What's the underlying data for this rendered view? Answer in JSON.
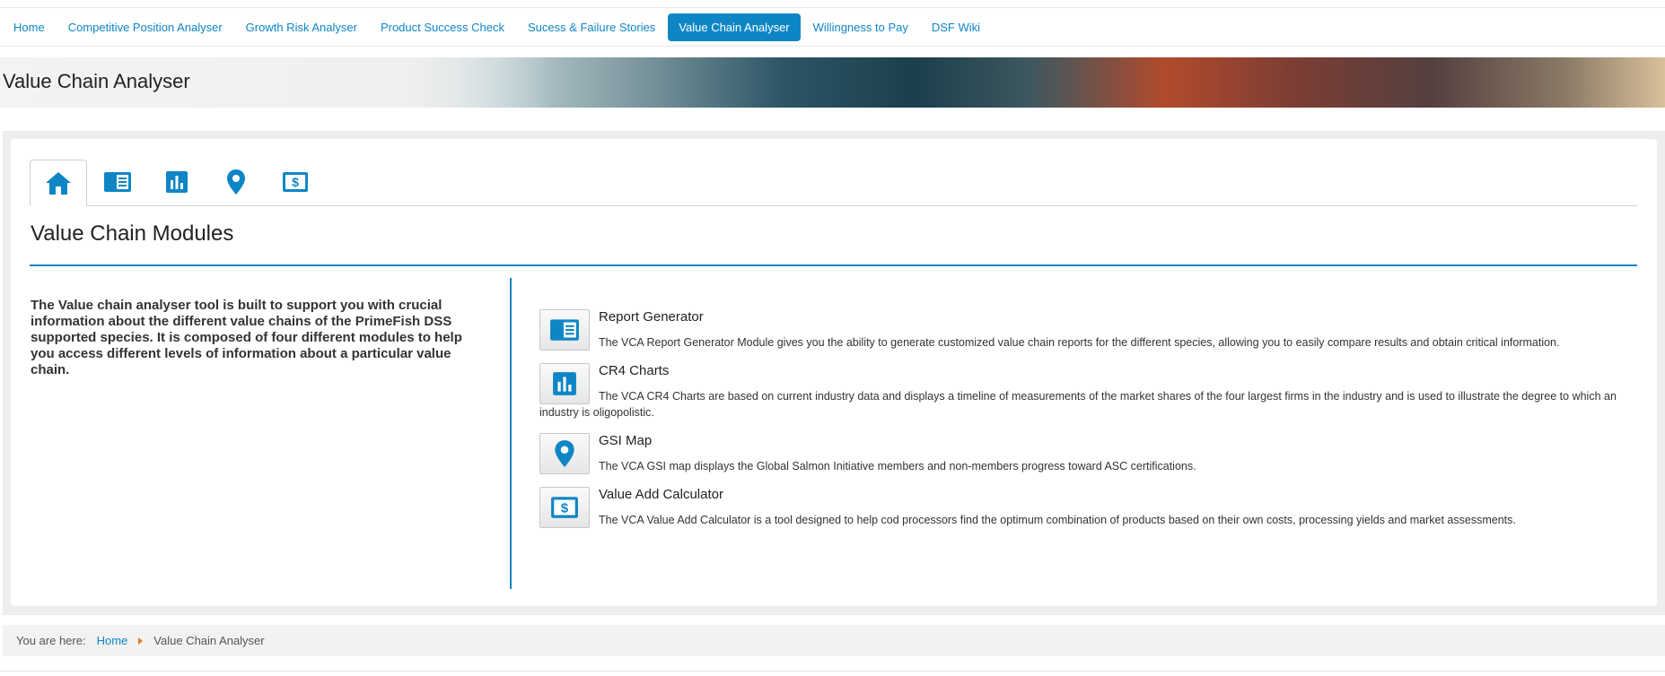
{
  "nav": {
    "items": [
      {
        "label": "Home",
        "active": false
      },
      {
        "label": "Competitive Position Analyser",
        "active": false
      },
      {
        "label": "Growth Risk Analyser",
        "active": false
      },
      {
        "label": "Product Success Check",
        "active": false
      },
      {
        "label": "Sucess & Failure Stories",
        "active": false
      },
      {
        "label": "Value Chain Analyser",
        "active": true
      },
      {
        "label": "Willingness to Pay",
        "active": false
      },
      {
        "label": "DSF Wiki",
        "active": false
      }
    ]
  },
  "banner": {
    "title": "Value Chain Analyser"
  },
  "tabs": [
    {
      "icon": "home-icon",
      "active": true
    },
    {
      "icon": "report-icon",
      "active": false
    },
    {
      "icon": "bar-chart-icon",
      "active": false
    },
    {
      "icon": "map-pin-icon",
      "active": false
    },
    {
      "icon": "dollar-icon",
      "active": false
    }
  ],
  "main": {
    "title": "Value Chain Modules",
    "intro": "The Value chain analyser tool is built to support you with crucial information about the different value chains of the PrimeFish DSS supported species. It is composed of four different modules to help you access different levels of information about a particular value chain.",
    "modules": [
      {
        "title": "Report Generator",
        "icon": "report-icon",
        "desc": "The VCA Report Generator Module gives you the ability to generate customized value chain reports for the different species, allowing you to easily compare results and obtain critical information."
      },
      {
        "title": "CR4 Charts",
        "icon": "bar-chart-icon",
        "desc": "The VCA CR4 Charts are based on current industry data and displays a timeline of measurements of the market shares of the four largest firms in the industry and is used to illustrate the degree to which an industry is oligopolistic."
      },
      {
        "title": "GSI Map",
        "icon": "map-pin-icon",
        "desc": "The VCA GSI map displays the Global Salmon Initiative members and non-members progress toward ASC certifications."
      },
      {
        "title": "Value Add Calculator",
        "icon": "dollar-icon",
        "desc": "The VCA Value Add Calculator is a tool designed to help cod processors find the optimum combination of products based on their own costs, processing yields and market assessments."
      }
    ]
  },
  "breadcrumb": {
    "label": "You are here:",
    "home": "Home",
    "current": "Value Chain Analyser"
  },
  "colors": {
    "accent": "#0e86c6",
    "separator": "#e07b28"
  }
}
